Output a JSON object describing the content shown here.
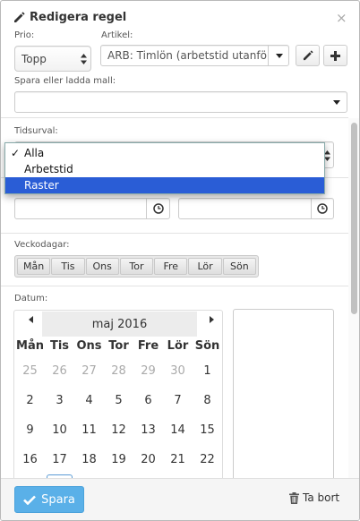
{
  "header": {
    "title": "Redigera regel",
    "edit_icon": "pencil-icon",
    "close_label": "×"
  },
  "form": {
    "prio": {
      "label": "Prio:",
      "value": "Topp"
    },
    "artikel": {
      "label": "Artikel:",
      "value": "ARB: Timlön (arbetstid utanfö"
    },
    "template": {
      "label": "Spara eller ladda mall:",
      "value": ""
    },
    "tidsurval": {
      "label": "Tidsurval:"
    },
    "dropdown": {
      "options": [
        "Alla",
        "Arbetstid",
        "Raster"
      ],
      "checked": "Alla",
      "highlighted": "Raster",
      "check_glyph": "✓"
    },
    "time_from": {
      "value": ""
    },
    "time_to": {
      "value": ""
    },
    "weekdays": {
      "label": "Veckodagar:",
      "days": [
        "Mån",
        "Tis",
        "Ons",
        "Tor",
        "Fre",
        "Lör",
        "Sön"
      ]
    },
    "date": {
      "label": "Datum:"
    }
  },
  "calendar": {
    "month": "maj 2016",
    "headers": [
      "Mån",
      "Tis",
      "Ons",
      "Tor",
      "Fre",
      "Lör",
      "Sön"
    ],
    "weeks": [
      [
        "25",
        "26",
        "27",
        "28",
        "29",
        "30",
        "1"
      ],
      [
        "2",
        "3",
        "4",
        "5",
        "6",
        "7",
        "8"
      ],
      [
        "9",
        "10",
        "11",
        "12",
        "13",
        "14",
        "15"
      ],
      [
        "16",
        "17",
        "18",
        "19",
        "20",
        "21",
        "22"
      ]
    ],
    "muted_first_row": 6
  },
  "footer": {
    "save_label": "Spara",
    "delete_label": "Ta bort"
  },
  "colors": {
    "accent": "#5ab0e8",
    "selection": "#2a5dd6"
  }
}
